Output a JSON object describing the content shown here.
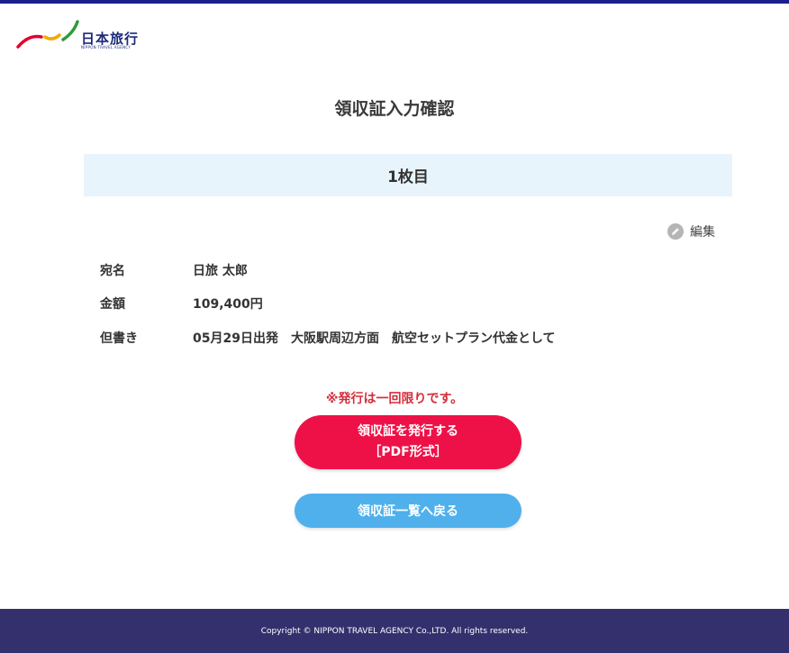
{
  "header": {
    "logo_text": "日本旅行",
    "logo_sub": "NIPPON TRAVEL AGENCY"
  },
  "page_title": "領収証入力確認",
  "sheet_label": "1枚目",
  "edit_label": "編集",
  "receipt": {
    "name_label": "宛名",
    "name_value": "日旅 太郎",
    "amount_label": "金額",
    "amount_value": "109,400円",
    "memo_label": "但書き",
    "memo_value": "05月29日出発　大阪駅周辺方面　航空セットプラン代金として"
  },
  "notice": "※発行は一回限りです。",
  "issue_button": {
    "line1": "領収証を発行する",
    "line2": "［PDF形式］"
  },
  "back_button": "領収証一覧へ戻る",
  "footer": {
    "copyright": "Copyright © NIPPON TRAVEL AGENCY Co.,LTD. All rights reserved."
  },
  "colors": {
    "top_stripe": "#1a1f8c",
    "issue_button": "#ee1148",
    "back_button": "#4fb0ec",
    "notice": "#d32f3c",
    "footer": "#34306e",
    "sheet_bar": "#e8f4fc"
  },
  "icons": [
    "logo-swoosh-icon",
    "pencil-icon"
  ]
}
